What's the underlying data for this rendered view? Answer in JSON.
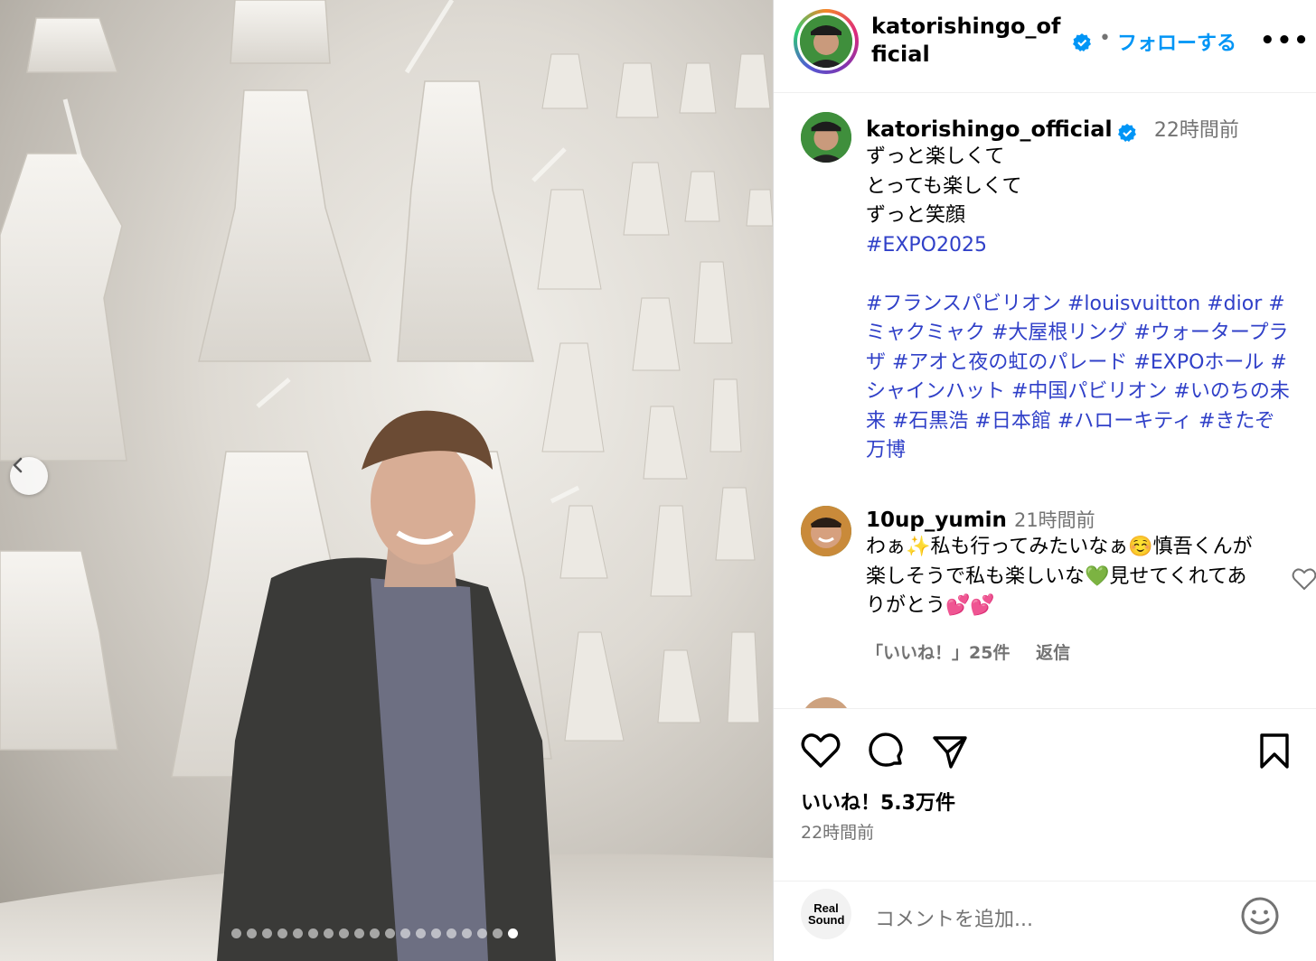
{
  "header": {
    "username": "katorishingo_official",
    "separator": "•",
    "follow_label": "フォローする",
    "more_label": "•••"
  },
  "caption": {
    "username": "katorishingo_official",
    "time": "22時間前",
    "lines": [
      "ずっと楽しくて",
      "とっても楽しくて",
      "ずっと笑顔"
    ],
    "first_tag": "#EXPO2025",
    "tags_text": "#フランスパビリオン #louisvuitton #dior #ミャクミャク #大屋根リング #ウォータープラザ #アオと夜の虹のパレード #EXPOホール #シャインハット #中国パビリオン #いのちの未来 #石黒浩 #日本館 #ハローキティ #きたぞ万博"
  },
  "comment": {
    "username": "10up_yumin",
    "time": "21時間前",
    "text": "わぁ✨私も行ってみたいなぁ☺️慎吾くんが楽しそうで私も楽しいな💚見せてくれてありがとう💕💕",
    "likes": "「いいね！」25件",
    "reply_label": "返信"
  },
  "actions": {
    "likes_text": "いいね！5.3万件",
    "time_text": "22時間前"
  },
  "composer": {
    "placeholder": "コメントを追加...",
    "logo_text": "Real Sound"
  },
  "carousel": {
    "total_slides": 19,
    "current_slide": 19
  },
  "colors": {
    "accent": "#0095f6",
    "hashtag": "#3040c8",
    "verified": "#0095f6",
    "muted": "#737373"
  }
}
